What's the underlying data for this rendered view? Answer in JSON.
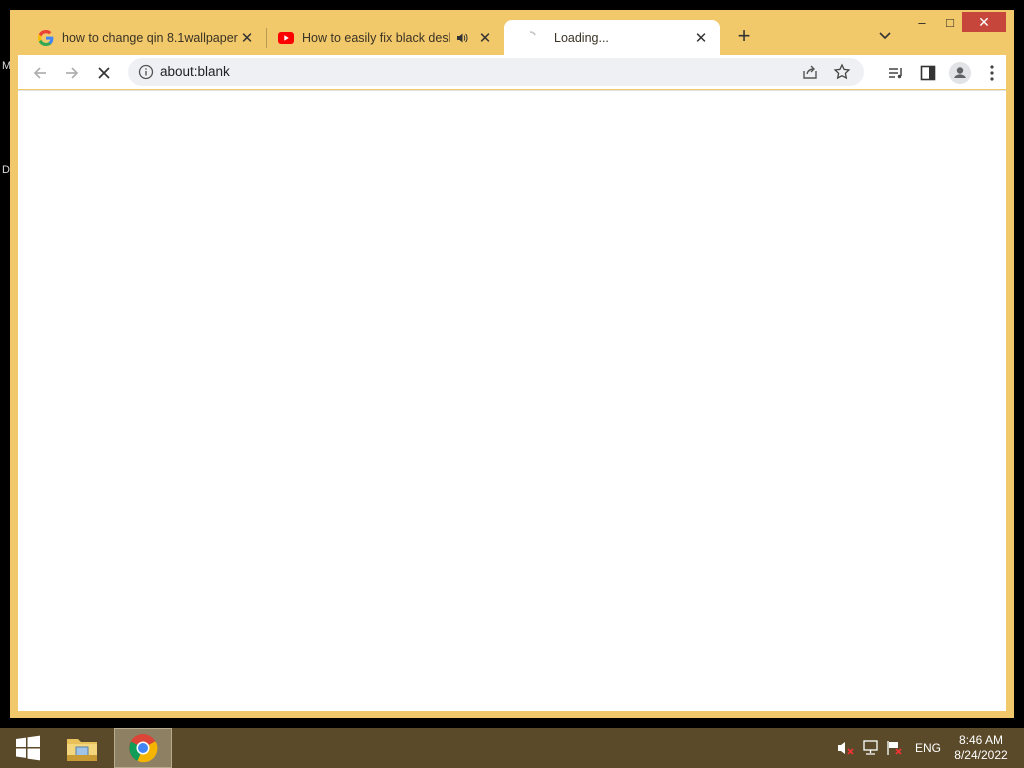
{
  "desktop": {
    "letter_top": "M",
    "letter_mid": "D"
  },
  "tabs": [
    {
      "title": "how to change qin 8.1wallpaper",
      "favicon": "google-icon"
    },
    {
      "title": "How to easily fix black deskto",
      "favicon": "youtube-icon",
      "audio": "speaker-icon"
    },
    {
      "title": "Loading...",
      "favicon": "loading-spinner"
    }
  ],
  "address_bar": {
    "url": "about:blank"
  },
  "window_controls": {
    "minimize": "–",
    "maximize": "□",
    "close": "✕"
  },
  "taskbar": {
    "language": "ENG",
    "time": "8:46 AM",
    "date": "8/24/2022"
  },
  "colors": {
    "frame": "#f1c86a",
    "taskbar": "#5a4a2a",
    "close_red": "#c7463b"
  }
}
